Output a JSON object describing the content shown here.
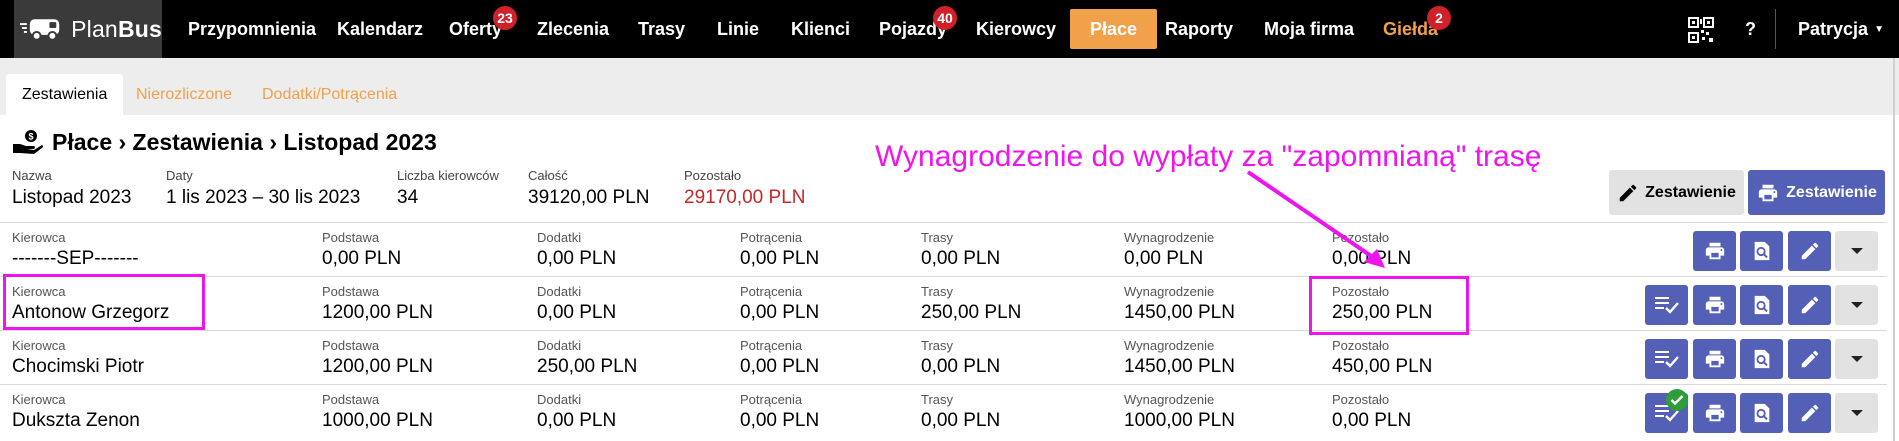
{
  "brand": {
    "name_light": "Plan",
    "name_bold": "Bus"
  },
  "nav": {
    "items": [
      {
        "label": "Przypomnienia"
      },
      {
        "label": "Kalendarz"
      },
      {
        "label": "Oferty",
        "badge": "23"
      },
      {
        "label": "Zlecenia"
      },
      {
        "label": "Trasy"
      },
      {
        "label": "Linie"
      },
      {
        "label": "Klienci"
      },
      {
        "label": "Pojazdy",
        "badge": "40"
      },
      {
        "label": "Kierowcy"
      },
      {
        "label": "Płace",
        "active": true
      },
      {
        "label": "Raporty"
      },
      {
        "label": "Moja firma"
      },
      {
        "label": "Giełda",
        "badge": "2",
        "highlight": true
      }
    ],
    "help": "?",
    "user": "Patrycja",
    "accent": "#f0a14a",
    "badge_color": "#d0212a"
  },
  "tabs": [
    {
      "label": "Zestawienia",
      "active": true
    },
    {
      "label": "Nierozliczone"
    },
    {
      "label": "Dodatki/Potrącenia"
    }
  ],
  "header": {
    "title": "Płace › Zestawienia › Listopad 2023",
    "fields": [
      {
        "label": "Nazwa",
        "value": "Listopad 2023"
      },
      {
        "label": "Daty",
        "value": "1 lis 2023 – 30 lis 2023"
      },
      {
        "label": "Liczba kierowców",
        "value": "34"
      },
      {
        "label": "Całość",
        "value": "39120,00 PLN"
      },
      {
        "label": "Pozostało",
        "value": "29170,00 PLN"
      }
    ],
    "edit_button": "Zestawienie",
    "print_button": "Zestawienie"
  },
  "annotation": "Wynagrodzenie do wypłaty za \"zapomnianą\" trasę",
  "table": {
    "columns": [
      "Kierowca",
      "Podstawa",
      "Dodatki",
      "Potrącenia",
      "Trasy",
      "Wynagrodzenie",
      "Pozostało"
    ],
    "rows": [
      {
        "cells": [
          "-------SEP-------",
          "0,00 PLN",
          "0,00 PLN",
          "0,00 PLN",
          "0,00 PLN",
          "0,00 PLN",
          "0,00 PLN"
        ],
        "settle": false,
        "checked": false
      },
      {
        "cells": [
          "Antonow Grzegorz",
          "1200,00 PLN",
          "0,00 PLN",
          "0,00 PLN",
          "250,00 PLN",
          "1450,00 PLN",
          "250,00 PLN"
        ],
        "settle": true,
        "checked": false
      },
      {
        "cells": [
          "Chocimski Piotr",
          "1200,00 PLN",
          "250,00 PLN",
          "0,00 PLN",
          "0,00 PLN",
          "1450,00 PLN",
          "450,00 PLN"
        ],
        "settle": true,
        "checked": false
      },
      {
        "cells": [
          "Dukszta Zenon",
          "1000,00 PLN",
          "0,00 PLN",
          "0,00 PLN",
          "0,00 PLN",
          "1000,00 PLN",
          "0,00 PLN"
        ],
        "settle": true,
        "checked": true
      }
    ]
  },
  "colors": {
    "primary_button": "#5360b6",
    "highlight": "#ee14ee",
    "negative_value": "#c62828",
    "ok_badge": "#2e9d3a"
  },
  "icons": [
    "bus-logo-icon",
    "qr-code-icon",
    "money-hand-icon",
    "pencil-icon",
    "printer-icon",
    "search-document-icon",
    "settle-list-icon",
    "chevron-down-icon",
    "check-icon"
  ]
}
